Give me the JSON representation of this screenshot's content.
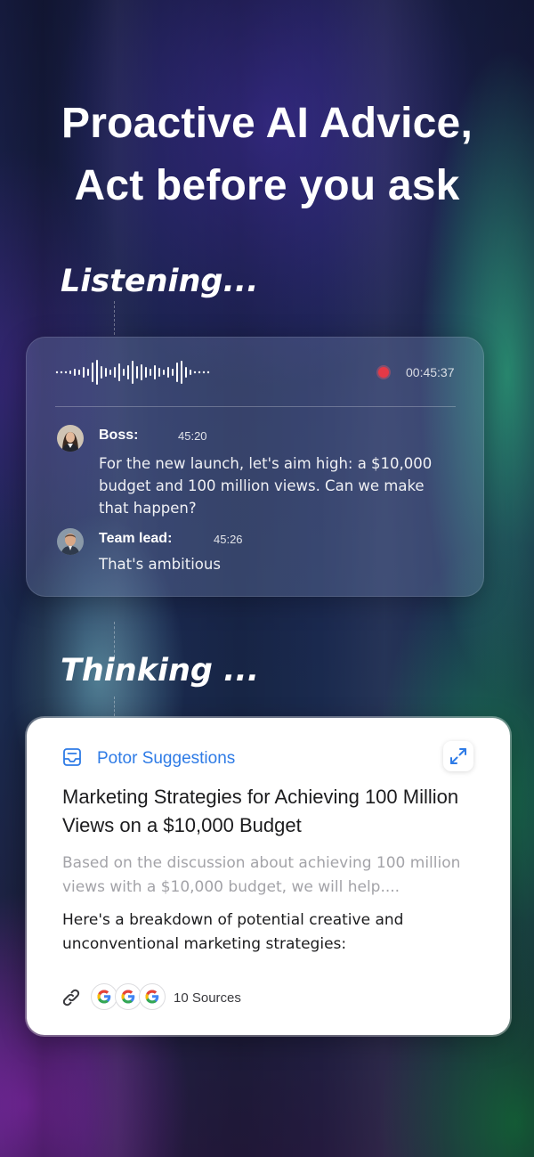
{
  "headline": {
    "line1": "Proactive AI Advice,",
    "line2": "Act before you ask"
  },
  "listening": {
    "label": "Listening...",
    "recording_time": "00:45:37",
    "messages": [
      {
        "name": "Boss:",
        "time": "45:20",
        "text": "For the new launch, let's aim high: a $10,000 budget and 100 million views. Can we make that happen?",
        "avatar": "female-avatar"
      },
      {
        "name": "Team lead:",
        "time": "45:26",
        "text": "That's ambitious",
        "avatar": "male-avatar"
      }
    ]
  },
  "thinking": {
    "label": "Thinking ...",
    "card": {
      "source_label": "Potor Suggestions",
      "title": "Marketing Strategies for Achieving 100 Million Views on a $10,000 Budget",
      "summary": "Based on the discussion about achieving 100 million views with a $10,000 budget, we will help....",
      "body": "Here's a breakdown of potential creative and unconventional marketing strategies:",
      "sources_count": "10 Sources",
      "source_icons": [
        "google-icon",
        "google-icon",
        "google-icon"
      ]
    }
  },
  "colors": {
    "accent_blue": "#2e7be6",
    "record_red": "#e53946",
    "card_white": "#ffffff"
  }
}
